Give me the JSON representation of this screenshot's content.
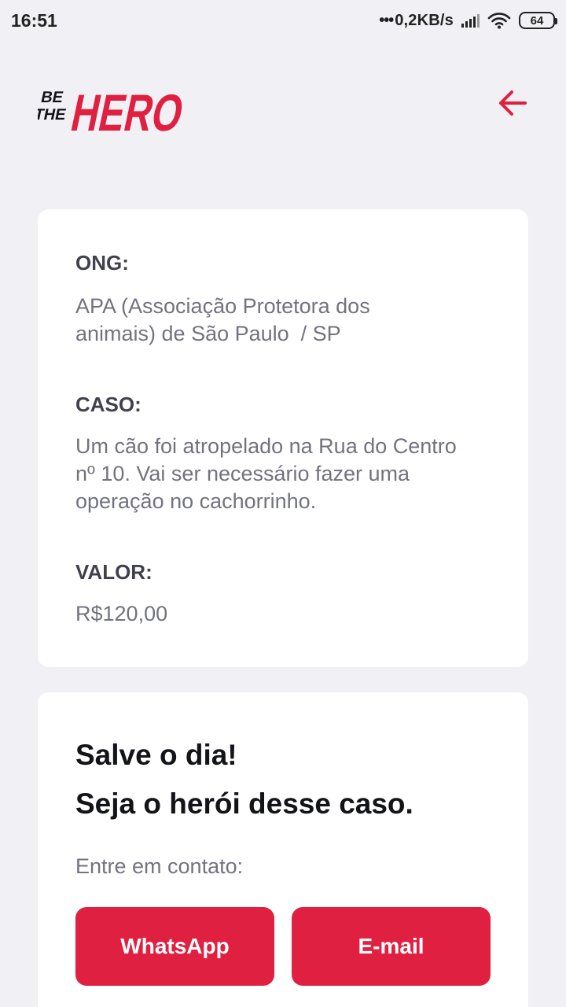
{
  "status_bar": {
    "time": "16:51",
    "net_speed": "0,2KB/s",
    "battery": "64",
    "icons": [
      "signal-icon",
      "wifi-icon",
      "battery-icon"
    ]
  },
  "header": {
    "logo_small_1": "BE",
    "logo_small_2": "THE",
    "logo_big": "HERO",
    "back_icon": "arrow-left-icon"
  },
  "incident": {
    "ong_label": "ONG:",
    "ong_value_line1": "APA (Associação Protetora dos",
    "ong_value_line2": "animais) de São Paulo  / SP",
    "case_label": "CASO:",
    "case_value_line1": "Um cão foi atropelado na Rua do Centro",
    "case_value_line2": "nº 10. Vai ser necessário fazer uma",
    "case_value_line3": "operação no cachorrinho.",
    "value_label": "VALOR:",
    "value_value": "R$120,00"
  },
  "contact": {
    "title_line1": "Salve o dia!",
    "title_line2": "Seja o herói desse caso.",
    "description": "Entre em contato:",
    "whatsapp_label": "WhatsApp",
    "email_label": "E-mail"
  },
  "colors": {
    "accent": "#e02041",
    "background": "#f0f0f5",
    "card": "#ffffff",
    "label": "#41414d",
    "text": "#737380"
  }
}
